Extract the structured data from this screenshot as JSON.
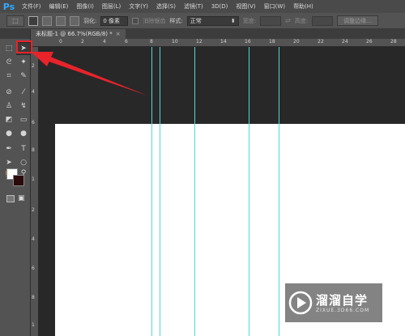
{
  "app": {
    "logo": "Ps"
  },
  "menu": [
    "文件(F)",
    "编辑(E)",
    "图像(I)",
    "图层(L)",
    "文字(Y)",
    "选择(S)",
    "滤镜(T)",
    "3D(D)",
    "视图(V)",
    "窗口(W)",
    "帮助(H)"
  ],
  "options": {
    "feather_label": "羽化:",
    "feather_value": "0 像素",
    "antialias_label": "消除锯齿",
    "style_label": "样式:",
    "style_value": "正常",
    "width_label": "宽度:",
    "height_label": "高度:",
    "refine_edge_button": "调整边缘..."
  },
  "document_tab": {
    "title": "未标题-1 @ 66.7%(RGB/8) *",
    "close": "×"
  },
  "ruler": {
    "top_labels": [
      "0",
      "2",
      "4",
      "6",
      "8",
      "10",
      "12",
      "14",
      "16",
      "18",
      "20",
      "22",
      "24",
      "26",
      "28"
    ],
    "left_labels": [
      "2",
      "4",
      "6",
      "8",
      "1",
      "2",
      "4",
      "6",
      "8",
      "1"
    ]
  },
  "colors": {
    "guide": "#4fd8d8",
    "annotation": "#e8232a",
    "ps_blue": "#31a8ff"
  },
  "watermark": {
    "title": "溜溜自学",
    "url": "ZIXUE.3D66.COM"
  }
}
